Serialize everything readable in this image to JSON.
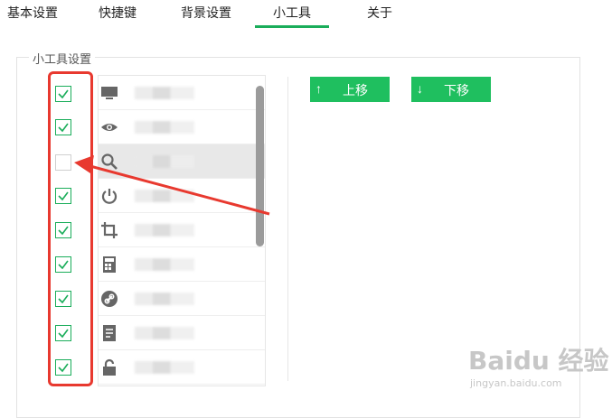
{
  "tabs": [
    {
      "label": "基本设置",
      "active": false
    },
    {
      "label": "快捷键",
      "active": false
    },
    {
      "label": "背景设置",
      "active": false
    },
    {
      "label": "小工具",
      "active": true
    },
    {
      "label": "关于",
      "active": false
    }
  ],
  "group": {
    "legend": "小工具设置"
  },
  "tools": [
    {
      "icon": "monitor-icon",
      "checked": true
    },
    {
      "icon": "eye-icon",
      "checked": true
    },
    {
      "icon": "search-icon",
      "checked": false,
      "selected": true
    },
    {
      "icon": "power-icon",
      "checked": true
    },
    {
      "icon": "crop-icon",
      "checked": true
    },
    {
      "icon": "calculator-icon",
      "checked": true
    },
    {
      "icon": "link-icon",
      "checked": true
    },
    {
      "icon": "document-icon",
      "checked": true
    },
    {
      "icon": "lock-icon",
      "checked": true
    }
  ],
  "buttons": {
    "up_label": "上移",
    "down_label": "下移",
    "up_arrow": "↑",
    "down_arrow": "↓"
  },
  "colors": {
    "accent": "#1aad5a",
    "button": "#1fbf5f",
    "annotation": "#e8392f"
  },
  "watermark": {
    "brand": "Baidu 经验",
    "url": "jingyan.baidu.com"
  }
}
